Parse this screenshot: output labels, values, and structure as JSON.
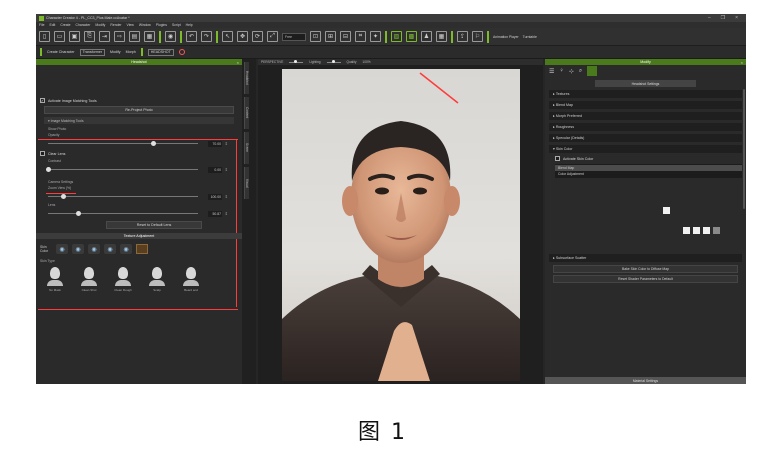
{
  "window": {
    "title": "Character Creator 4 - PL_CC3_Plus Male.ccAvatar *",
    "controls": [
      "–",
      "❐",
      "×"
    ]
  },
  "menu": [
    "File",
    "Edit",
    "Create",
    "Character",
    "Modify",
    "Render",
    "View",
    "Window",
    "Plugins",
    "Script",
    "Help"
  ],
  "toolbar": {
    "view_select": "Free"
  },
  "toolbar2": {
    "create_character": "Create Character",
    "transformer": "Transformer",
    "modify": "Modify",
    "morph": "Morph",
    "headshot": "HEADSHOT",
    "animation_player": "Animation Player",
    "turntable": "Turntable"
  },
  "left_panel": {
    "title": "Headshot",
    "activate_label": "Activate Image Matching Tools",
    "re_project_photo": "Re-Project Photo",
    "image_matching_tools": "Image Matching Tools",
    "show_photo": "Show Photo",
    "opacity_label": "Opacity",
    "opacity_value": "70.00",
    "opacity_level": 0.7,
    "clear_lens": "Clear Lens",
    "contrast_label": "Contrast",
    "contrast_value": "0.00",
    "contrast_level": 0.0,
    "camera_settings": "Camera Settings",
    "zoom_label": "Zoom View (%)",
    "zoom_value": "100.00",
    "zoom_level": 0.1,
    "lens_label": "Lens",
    "lens_value": "50.87",
    "lens_level": 0.2,
    "reset_defaults": "Reset to Default Lens",
    "texture_adjustment": "Texture Adjustment",
    "skin_color_label": "Skin Color",
    "skin_type_label": "Skin Type",
    "avatars": [
      "No Mask",
      "Clean Shot",
      "Clean Rough",
      "Scalp",
      "Beard and"
    ]
  },
  "side_tabs": [
    "Headshot",
    "Content",
    "Scene",
    "Visual"
  ],
  "viewport": {
    "camera": "PERSPECTIVE",
    "lighting": "Lighting",
    "quality": "Quality",
    "quality_value": "100%"
  },
  "right_panel": {
    "title": "Modify",
    "header_btn": "Headshot Settings",
    "sections": [
      "Textures",
      "Blend Map",
      "Morph Preferred",
      "Roughness",
      "Specular (Details)"
    ],
    "skin_color": "Skin Color",
    "activate_skin_color": "Activate Skin Color",
    "list_items": [
      "Blend Map",
      "Color Adjustment"
    ],
    "subsurface": "Subsurface Scatter",
    "btn_bake": "Bake Skin Color to Diffuse Map",
    "btn_reset": "Reset Shader Parameters to Default",
    "material_settings": "Material Settings"
  },
  "caption": "图 1"
}
